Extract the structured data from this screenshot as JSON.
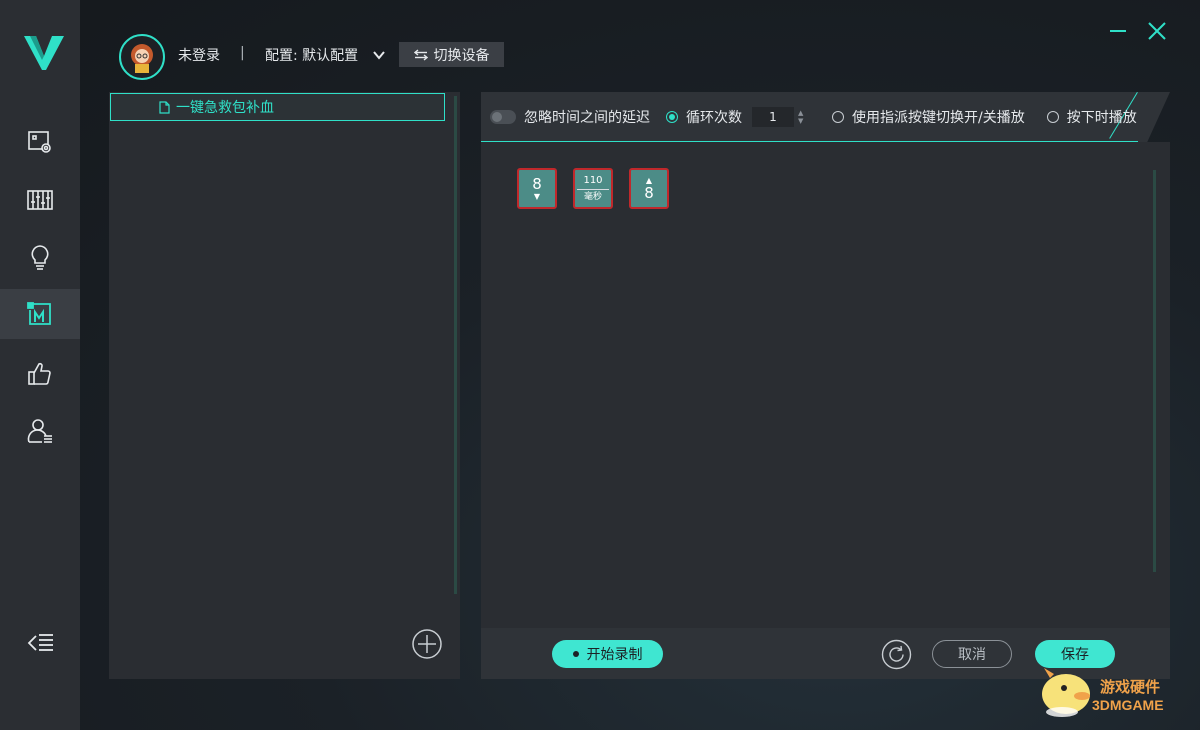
{
  "header": {
    "login_status": "未登录",
    "separator": "|",
    "config_label": "配置: 默认配置",
    "switch_device_label": "切换设备"
  },
  "sidebar": {
    "items": [
      {
        "icon": "screen-settings-icon"
      },
      {
        "icon": "equalizer-icon"
      },
      {
        "icon": "lightbulb-icon"
      },
      {
        "icon": "macro-icon",
        "active": true
      },
      {
        "icon": "thumbs-up-icon"
      },
      {
        "icon": "user-list-icon"
      }
    ]
  },
  "macro_list": {
    "items": [
      {
        "label": "一键急救包补血",
        "selected": true
      }
    ]
  },
  "toolbar": {
    "ignore_delay_label": "忽略时间之间的延迟",
    "loop_count_label": "循环次数",
    "loop_count_value": "1",
    "toggle_by_key_label": "使用指派按键切换开/关播放",
    "play_while_pressed_label": "按下时播放"
  },
  "sequence": [
    {
      "type": "key",
      "key": "8",
      "direction": "down",
      "arrow": "▼"
    },
    {
      "type": "delay",
      "value": "110",
      "unit": "毫秒"
    },
    {
      "type": "key",
      "key": "8",
      "direction": "up",
      "arrow": "▲"
    }
  ],
  "footer": {
    "record_label": "开始录制",
    "cancel_label": "取消",
    "save_label": "保存"
  },
  "watermark": {
    "text_cn": "游戏硬件",
    "text_en": "3DMGAME"
  },
  "colors": {
    "accent": "#2fe0c8",
    "button_fill": "#3fe6d1",
    "key_block": "#4c8c87",
    "key_border": "#c0282b"
  }
}
